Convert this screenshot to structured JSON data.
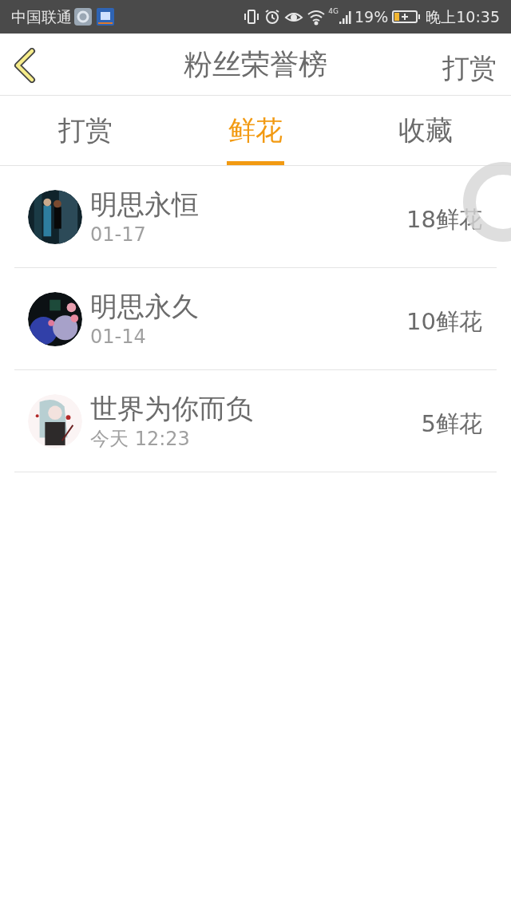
{
  "status_bar": {
    "carrier": "中国联通",
    "battery_text": "19%",
    "time": "晚上10:35",
    "network": "4G"
  },
  "header": {
    "title": "粉丝荣誉榜",
    "action": "打赏"
  },
  "tabs": [
    {
      "label": "打赏",
      "selected": false
    },
    {
      "label": "鲜花",
      "selected": true
    },
    {
      "label": "收藏",
      "selected": false
    }
  ],
  "rows": [
    {
      "name": "明思永恒",
      "date": "01-17",
      "amount": "18鲜花"
    },
    {
      "name": "明思永久",
      "date": "01-14",
      "amount": "10鲜花"
    },
    {
      "name": "世界为你而负",
      "date": "今天 12:23",
      "amount": "5鲜花"
    }
  ]
}
